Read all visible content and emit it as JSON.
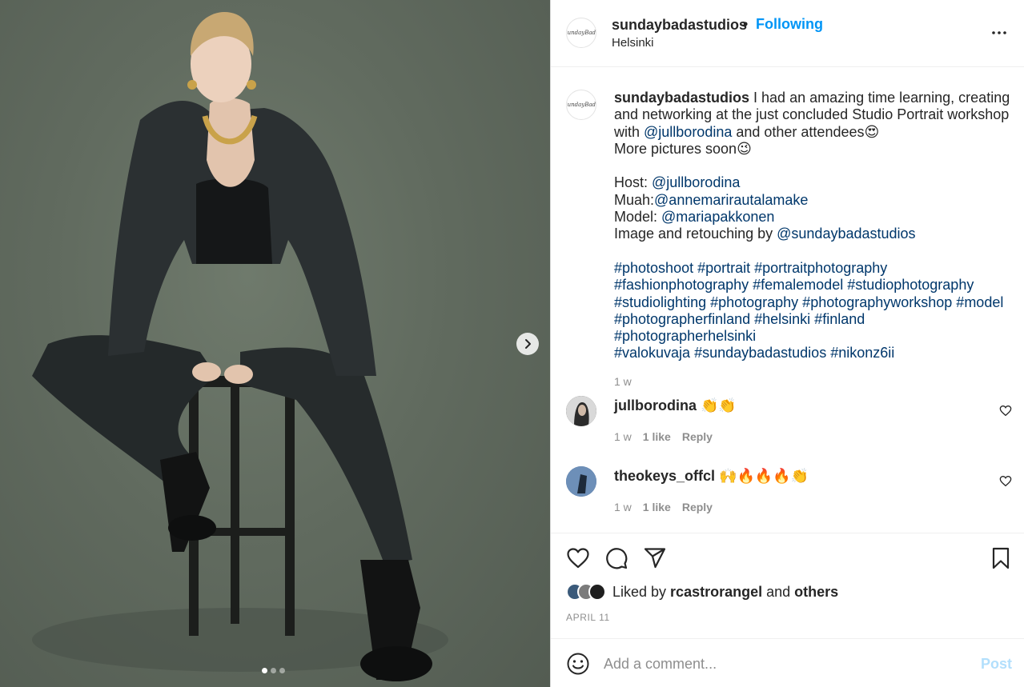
{
  "post": {
    "username": "sundaybadastudios",
    "separator": "•",
    "follow_status": "Following",
    "location": "Helsinki",
    "logo_text": "SundayBada"
  },
  "caption": {
    "username": "sundaybadastudios",
    "line1_text": " I had an amazing time learning, creating and networking at the just concluded Studio Portrait workshop with ",
    "line1_mention": "@jullborodina",
    "line1_tail": " and other attendees😍",
    "line2": "More pictures soon😉",
    "host_label": "Host: ",
    "host_mention": "@jullborodina",
    "muah_label": "Muah:",
    "muah_mention": "@annemarirautalamake",
    "model_label": "Model: ",
    "model_mention": "@mariapakkonen",
    "image_label": "Image and retouching by ",
    "image_mention": "@sundaybadastudios",
    "hashtags": [
      "#photoshoot",
      "#portrait",
      "#portraitphotography",
      "#fashionphotography",
      "#femalemodel",
      "#studiophotography",
      "#studiolighting",
      "#photography",
      "#photographyworkshop",
      "#model",
      "#photographerfinland",
      "#helsinki",
      "#finland",
      "#photographerhelsinki",
      "#valokuvaja",
      "#sundaybadastudios",
      "#nikonz6ii"
    ],
    "hashtag_line1": "#photoshoot #portrait #portraitphotography",
    "hashtag_line2": "#fashionphotography #femalemodel #studiophotography",
    "hashtag_line3": "#studiolighting #photography #photographyworkshop #model",
    "hashtag_line4": "#photographerfinland #helsinki #finland #photographerhelsinki",
    "hashtag_line5": "#valokuvaja #sundaybadastudios #nikonz6ii",
    "time": "1 w"
  },
  "comments": [
    {
      "username": "jullborodina",
      "text": "👏👏",
      "time": "1 w",
      "likes": "1 like",
      "reply": "Reply"
    },
    {
      "username": "theokeys_offcl",
      "text": "🙌🔥🔥🔥👏",
      "time": "1 w",
      "likes": "1 like",
      "reply": "Reply"
    }
  ],
  "likes": {
    "prefix": "Liked by ",
    "user": "rcastrorangel",
    "middle": " and ",
    "others": "others"
  },
  "date": "APRIL 11",
  "composer": {
    "placeholder": "Add a comment...",
    "post_label": "Post"
  },
  "carousel": {
    "current": 1,
    "total": 3
  },
  "icons": {
    "more": "more-options-icon",
    "next": "chevron-right-icon",
    "like": "heart-icon",
    "comment": "comment-bubble-icon",
    "share": "paper-plane-icon",
    "save": "bookmark-icon",
    "emoji": "emoji-icon"
  },
  "colors": {
    "link": "#00376b",
    "follow": "#0095f6",
    "post_disabled": "#b2dffc",
    "muted": "#8e8e8e",
    "photo_background": "#616b5f"
  }
}
